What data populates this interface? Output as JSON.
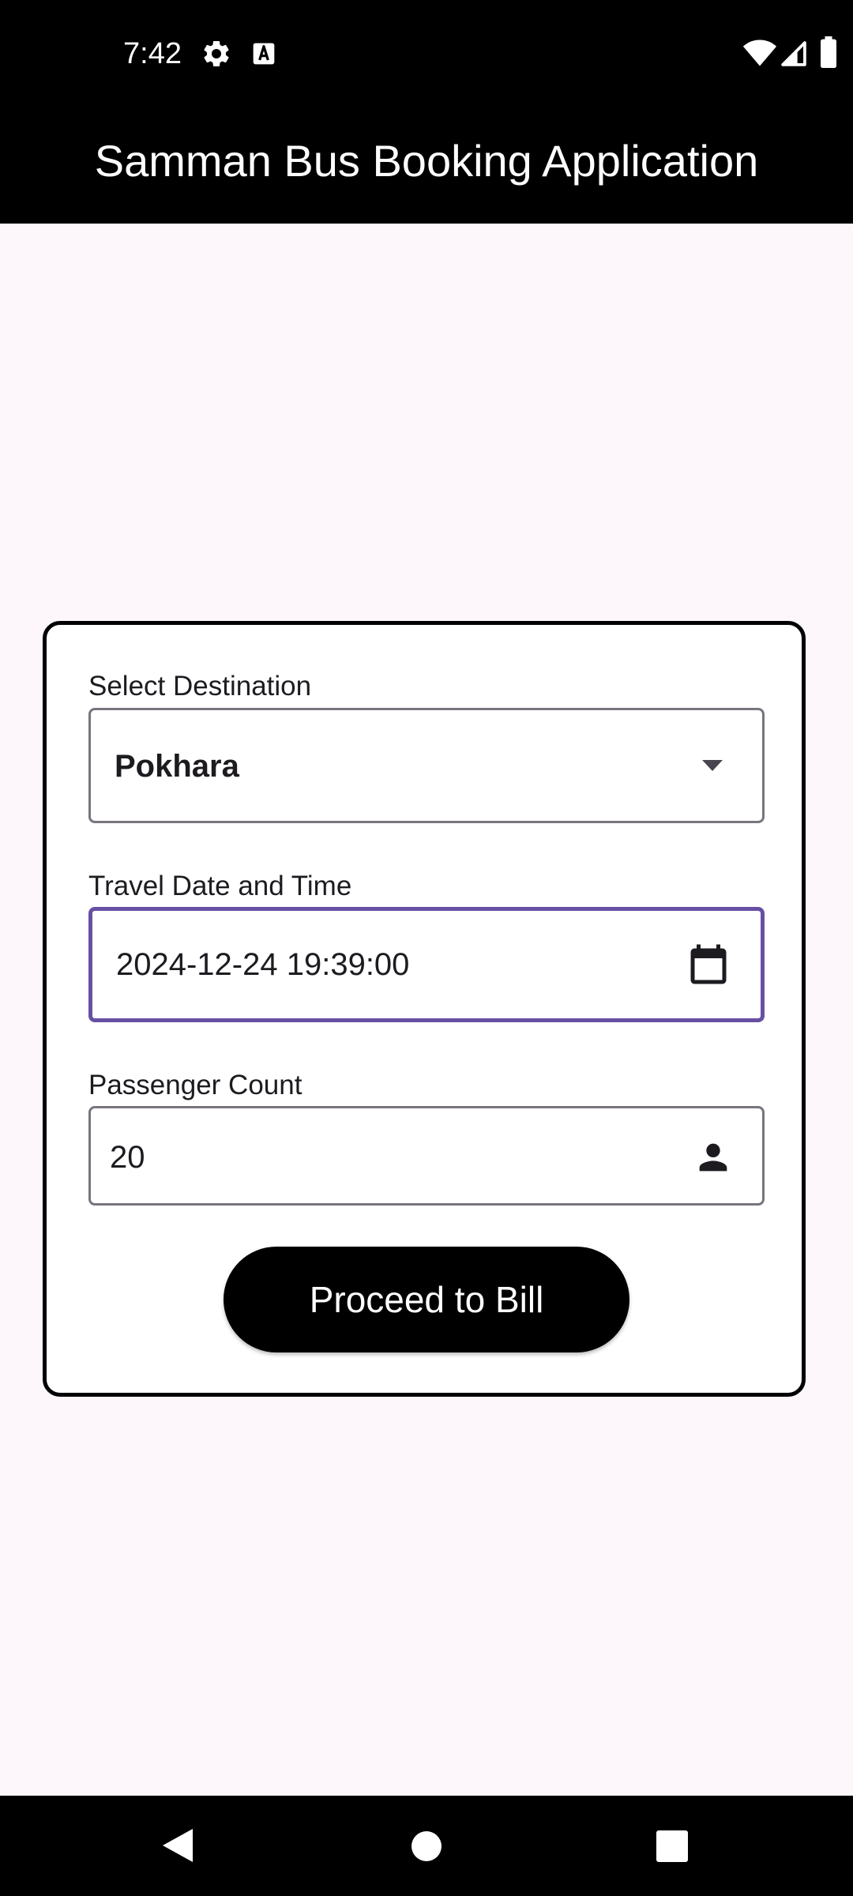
{
  "status_bar": {
    "time": "7:42",
    "left_icons": [
      "gear-icon",
      "text-a-icon"
    ],
    "right_icons": [
      "wifi-icon",
      "signal-icon",
      "battery-icon"
    ]
  },
  "app_bar": {
    "title": "Samman Bus Booking Application",
    "background": "#000000"
  },
  "form": {
    "destination": {
      "label": "Select Destination",
      "selected": "Pokhara",
      "icon": "dropdown-arrow-icon"
    },
    "travel_date": {
      "label": "Travel Date and Time",
      "value": "2024-12-24 19:39:00",
      "icon": "calendar-icon"
    },
    "passenger_count": {
      "label": "Passenger Count",
      "value": "20",
      "icon": "person-icon"
    },
    "submit_label": "Proceed to Bill"
  },
  "colors": {
    "focus_border": "#6750a4",
    "page_background": "#fdf7fc",
    "button_background": "#000000"
  },
  "nav_bar": {
    "icons": [
      "back-icon",
      "home-icon",
      "recents-icon"
    ]
  }
}
